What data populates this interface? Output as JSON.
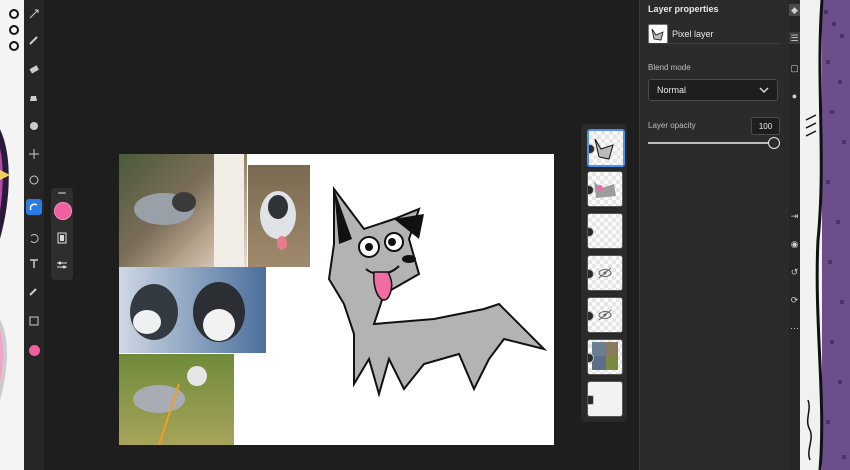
{
  "props": {
    "title": "Layer properties",
    "layer_name": "Pixel layer",
    "blend_mode_label": "Blend mode",
    "blend_mode_value": "Normal",
    "opacity_label": "Layer opacity",
    "opacity_value": "100",
    "opacity_percent": 100
  },
  "tool_colors": {
    "active": "#2a7be4",
    "swatch": "#f0609e"
  },
  "toolbar": {
    "tools": [
      "move-icon",
      "brush-icon",
      "eraser-icon",
      "fill-icon",
      "smudge-icon",
      "transform-icon",
      "selection-icon",
      "lasso-icon",
      "undo-icon",
      "text-icon",
      "eyedropper-icon",
      "crop-icon"
    ]
  },
  "layers": [
    {
      "name": "layer-1",
      "selected": true,
      "visible": true
    },
    {
      "name": "layer-2",
      "selected": false,
      "visible": true
    },
    {
      "name": "layer-3",
      "selected": false,
      "visible": true
    },
    {
      "name": "layer-4",
      "selected": false,
      "visible": false
    },
    {
      "name": "layer-5",
      "selected": false,
      "visible": false
    },
    {
      "name": "layer-6",
      "selected": false,
      "visible": true
    },
    {
      "name": "layer-7",
      "selected": false,
      "visible": true
    }
  ]
}
